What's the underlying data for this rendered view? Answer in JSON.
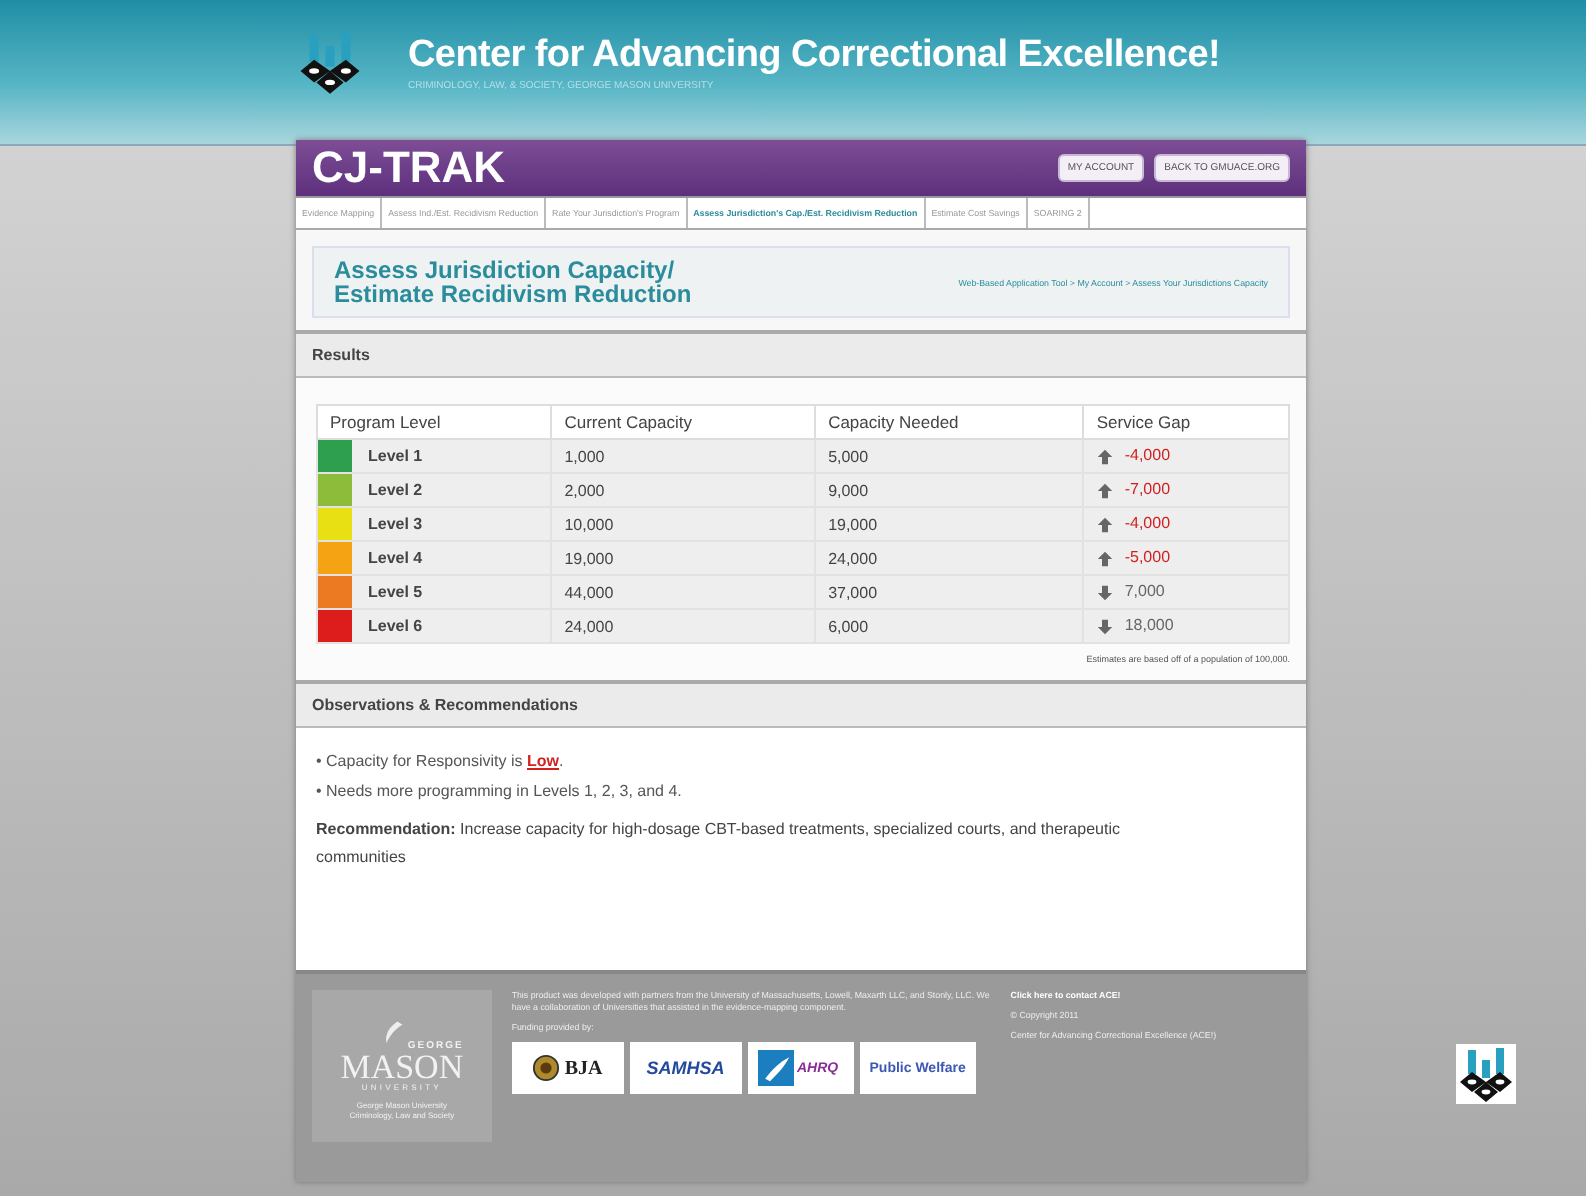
{
  "header": {
    "title": "Center for Advancing Correctional Excellence!",
    "subtitle": "CRIMINOLOGY, LAW, & SOCIETY, GEORGE MASON UNIVERSITY"
  },
  "app_bar": {
    "title": "CJ-TRAK",
    "buttons": [
      "MY ACCOUNT",
      "BACK TO GMUACE.ORG"
    ]
  },
  "tabs": [
    {
      "label": "Evidence Mapping",
      "selected": false
    },
    {
      "label": "Assess Ind./Est. Recidivism Reduction",
      "selected": false
    },
    {
      "label": "Rate Your Jurisdiction's Program",
      "selected": false
    },
    {
      "label": "Assess Jurisdiction's Cap./Est. Recidivism Reduction",
      "selected": true
    },
    {
      "label": "Estimate Cost Savings",
      "selected": false
    },
    {
      "label": "SOARING 2",
      "selected": false
    }
  ],
  "page_title": [
    "Assess Jurisdiction Capacity/",
    "Estimate Recidivism Reduction"
  ],
  "breadcrumb": "Web-Based Application Tool > My Account > Assess Your Jurisdictions Capacity",
  "results": {
    "heading": "Results",
    "columns": [
      "Program Level",
      "Current Capacity",
      "Capacity Needed",
      "Service Gap"
    ],
    "rows": [
      {
        "level": "Level 1",
        "color": "#2e9e4f",
        "current": "1,000",
        "needed": "5,000",
        "gap": "-4,000",
        "kind": "up"
      },
      {
        "level": "Level 2",
        "color": "#8dbb3a",
        "current": "2,000",
        "needed": "9,000",
        "gap": "-7,000",
        "kind": "up"
      },
      {
        "level": "Level 3",
        "color": "#e8e012",
        "current": "10,000",
        "needed": "19,000",
        "gap": "-4,000",
        "kind": "up"
      },
      {
        "level": "Level 4",
        "color": "#f5a312",
        "current": "19,000",
        "needed": "24,000",
        "gap": "-5,000",
        "kind": "up"
      },
      {
        "level": "Level 5",
        "color": "#ec7a22",
        "current": "44,000",
        "needed": "37,000",
        "gap": "7,000",
        "kind": "down"
      },
      {
        "level": "Level 6",
        "color": "#dd1c1c",
        "current": "24,000",
        "needed": "6,000",
        "gap": "18,000",
        "kind": "down"
      }
    ],
    "note": "Estimates are based off of a population of 100,000."
  },
  "observations": {
    "heading": "Observations & Recommendations",
    "bullets": [
      "• Capacity for Responsivity is **Low**.",
      "• Needs more programming in Levels 1, 2, 3, and 4."
    ],
    "recommendation": "**Recommendation:** Increase capacity for high-dosage CBT-based treatments, specialized courts, and therapeutic communities"
  },
  "footer": {
    "university": {
      "wordmark_top": "GEORGE",
      "wordmark": "MASON",
      "wordmark_bottom": "UNIVERSITY",
      "caption": [
        "George Mason University",
        "Criminology, Law and Society"
      ]
    },
    "about": "This product was developed with partners from the University of Massachusetts, Lowell, Maxarth LLC, and Stonly, LLC. We have a collaboration of Universities that assisted in the evidence-mapping component.",
    "funding_label": "Funding provided by:",
    "funders": [
      "BJA",
      "SAMHSA",
      "AHRQ",
      "Public Welfare"
    ],
    "contact_link": "Click here to contact ACE!",
    "copyright": [
      "© Copyright 2011",
      "Center for Advancing Correctional Excellence (ACE!)"
    ]
  }
}
